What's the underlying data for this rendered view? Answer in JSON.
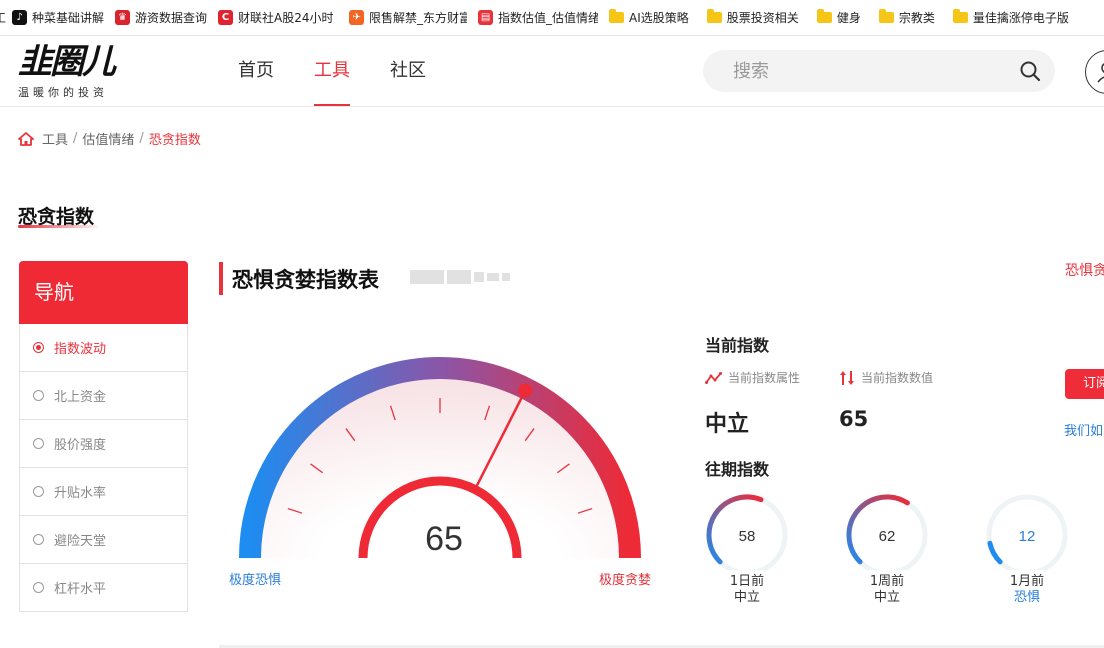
{
  "bookmarks": [
    {
      "label": "种菜基础讲解",
      "icon": "tiktok-icon",
      "color": "#111111",
      "glyph": "♪"
    },
    {
      "label": "游资数据查询",
      "icon": "crown-icon",
      "color": "#d9232d",
      "glyph": "♛"
    },
    {
      "label": "财联社A股24小时",
      "icon": "cailianshe-icon",
      "color": "#e0242f",
      "glyph": "C"
    },
    {
      "label": "限售解禁_东方财富",
      "icon": "eastmoney-icon",
      "color": "#f26522",
      "glyph": "✈"
    },
    {
      "label": "指数估值_估值情绪",
      "icon": "index-site-icon",
      "color": "#e8323c",
      "glyph": "▤"
    },
    {
      "label": "AI选股策略",
      "icon": "folder-icon"
    },
    {
      "label": "股票投资相关",
      "icon": "folder-icon"
    },
    {
      "label": "健身",
      "icon": "folder-icon"
    },
    {
      "label": "宗教类",
      "icon": "folder-icon"
    },
    {
      "label": "量佳擒涨停电子版",
      "icon": "folder-icon"
    }
  ],
  "header": {
    "logo_main": "韭圈儿",
    "logo_sub": "温暖你的投资",
    "nav": [
      "首页",
      "工具",
      "社区"
    ],
    "nav_active": 1,
    "search_placeholder": "搜索"
  },
  "breadcrumb": {
    "home": "工具",
    "mid": "估值情绪",
    "current": "恐贪指数"
  },
  "page_title": "恐贪指数",
  "sidebar": {
    "title": "导航",
    "items": [
      "指数波动",
      "北上资金",
      "股价强度",
      "升贴水率",
      "避险天堂",
      "杠杆水平"
    ],
    "active": 0
  },
  "section": {
    "title": "恐惧贪婪指数表",
    "right_link": "恐惧贪"
  },
  "gauge": {
    "value": "65",
    "min_label": "极度恐惧",
    "max_label": "极度贪婪",
    "min": 0,
    "max": 100,
    "reading": 65
  },
  "current": {
    "title": "当前指数",
    "attr_label": "当前指数属性",
    "value_label": "当前指数数值",
    "attr": "中立",
    "value": "65"
  },
  "history": {
    "title": "往期指数",
    "items": [
      {
        "value": "58",
        "when": "1日前",
        "attr": "中立",
        "fraction": 0.58,
        "color": "#2a7fd8"
      },
      {
        "value": "62",
        "when": "1周前",
        "attr": "中立",
        "fraction": 0.62,
        "color": "#2a7fd8"
      },
      {
        "value": "12",
        "when": "1月前",
        "attr": "恐惧",
        "fraction": 0.12,
        "color": "#2a7fd8"
      }
    ]
  },
  "subscribe_label": "订阅",
  "bottom_link": "我们如"
}
